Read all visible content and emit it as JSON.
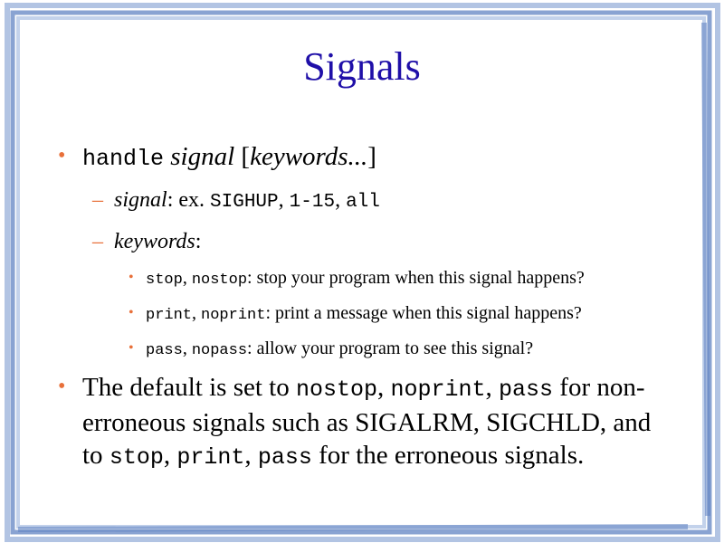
{
  "slide": {
    "title": "Signals",
    "item1": {
      "cmd": "handle",
      "arg": "signal",
      "bracket_open": "[",
      "keywords": "keywords...",
      "bracket_close": "]"
    },
    "sub1": {
      "label": "signal",
      "colon_ex": ": ex. ",
      "v1": "SIGHUP",
      "c1": ", ",
      "v2": "1-15",
      "c2": ", ",
      "v3": "all"
    },
    "sub2": {
      "label": "keywords",
      "colon": ":"
    },
    "subsub": [
      {
        "k1": "stop",
        "sep": ", ",
        "k2": "nostop",
        "desc": ": stop your program when this signal happens?"
      },
      {
        "k1": "print",
        "sep": ", ",
        "k2": "noprint",
        "desc": ": print a message when this signal happens?"
      },
      {
        "k1": "pass",
        "sep": ", ",
        "k2": "nopass",
        "desc": ": allow your program to see this signal?"
      }
    ],
    "item2": {
      "t1": "The default is set to ",
      "m1": "nostop",
      "s1": ", ",
      "m2": "noprint",
      "s2": ", ",
      "m3": "pass",
      "t2": " for non-erroneous signals such as SIGALRM, SIGCHLD, and to ",
      "m4": "stop",
      "s3": ", ",
      "m5": "print",
      "s4": ", ",
      "m6": "pass",
      "t3": " for the erroneous signals."
    }
  },
  "colors": {
    "title": "#1f0fa8",
    "bullet": "#e8703a",
    "frame": "#7f9dd0"
  }
}
